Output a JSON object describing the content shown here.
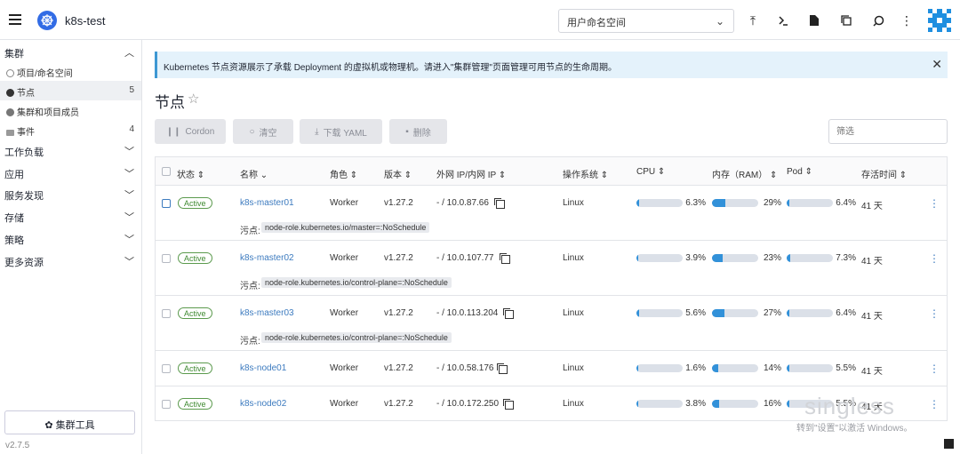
{
  "header": {
    "cluster": "k8s-test",
    "namespace_select": "用户命名空间"
  },
  "sidebar": {
    "group_cluster": "集群",
    "items": [
      {
        "label": "项目/命名空间",
        "count": ""
      },
      {
        "label": "节点",
        "count": "5"
      },
      {
        "label": "集群和项目成员",
        "count": ""
      },
      {
        "label": "事件",
        "count": "4"
      }
    ],
    "groups": [
      "工作负载",
      "应用",
      "服务发现",
      "存储",
      "策略",
      "更多资源"
    ],
    "tools_button": "集群工具",
    "version": "v2.7.5"
  },
  "banner": {
    "text": "Kubernetes 节点资源展示了承载 Deployment 的虚拟机或物理机。请进入\"集群管理\"页面管理可用节点的生命周期。"
  },
  "page": {
    "title": "节点"
  },
  "actions": {
    "cordon": "Cordon",
    "drain": "清空",
    "download": "下载 YAML",
    "delete": "删除",
    "filter_placeholder": "筛选"
  },
  "table": {
    "headers": {
      "state": "状态",
      "name": "名称",
      "role": "角色",
      "version": "版本",
      "ip": "外网 IP/内网 IP",
      "os": "操作系统",
      "cpu": "CPU",
      "ram": "内存（RAM）",
      "pod": "Pod",
      "age": "存活时间"
    },
    "taint_label": "污点:",
    "rows": [
      {
        "state": "Active",
        "name": "k8s-master01",
        "role": "Worker",
        "version": "v1.27.2",
        "ip": "- / 10.0.87.66",
        "os": "Linux",
        "cpu": "6.3%",
        "cpu_v": 6.3,
        "ram": "29%",
        "ram_v": 29,
        "pod": "6.4%",
        "pod_v": 6.4,
        "age": "41 天",
        "taint": "node-role.kubernetes.io/master=:NoSchedule"
      },
      {
        "state": "Active",
        "name": "k8s-master02",
        "role": "Worker",
        "version": "v1.27.2",
        "ip": "- / 10.0.107.77",
        "os": "Linux",
        "cpu": "3.9%",
        "cpu_v": 3.9,
        "ram": "23%",
        "ram_v": 23,
        "pod": "7.3%",
        "pod_v": 7.3,
        "age": "41 天",
        "taint": "node-role.kubernetes.io/control-plane=:NoSchedule"
      },
      {
        "state": "Active",
        "name": "k8s-master03",
        "role": "Worker",
        "version": "v1.27.2",
        "ip": "- / 10.0.113.204",
        "os": "Linux",
        "cpu": "5.6%",
        "cpu_v": 5.6,
        "ram": "27%",
        "ram_v": 27,
        "pod": "6.4%",
        "pod_v": 6.4,
        "age": "41 天",
        "taint": "node-role.kubernetes.io/control-plane=:NoSchedule"
      },
      {
        "state": "Active",
        "name": "k8s-node01",
        "role": "Worker",
        "version": "v1.27.2",
        "ip": "- / 10.0.58.176",
        "os": "Linux",
        "cpu": "1.6%",
        "cpu_v": 1.6,
        "ram": "14%",
        "ram_v": 14,
        "pod": "5.5%",
        "pod_v": 5.5,
        "age": "41 天",
        "taint": ""
      },
      {
        "state": "Active",
        "name": "k8s-node02",
        "role": "Worker",
        "version": "v1.27.2",
        "ip": "- / 10.0.172.250",
        "os": "Linux",
        "cpu": "3.8%",
        "cpu_v": 3.8,
        "ram": "16%",
        "ram_v": 16,
        "pod": "5.5%",
        "pod_v": 5.5,
        "age": "41 天",
        "taint": ""
      }
    ]
  },
  "watermark": {
    "brand": "singless",
    "activate": "转到\"设置\"以激活 Windows。"
  },
  "colors": {
    "accent": "#3d7bbf",
    "bar_fill": "#3291d9",
    "active_green": "#3f8a31",
    "banner_bg": "#e4f2fb"
  }
}
